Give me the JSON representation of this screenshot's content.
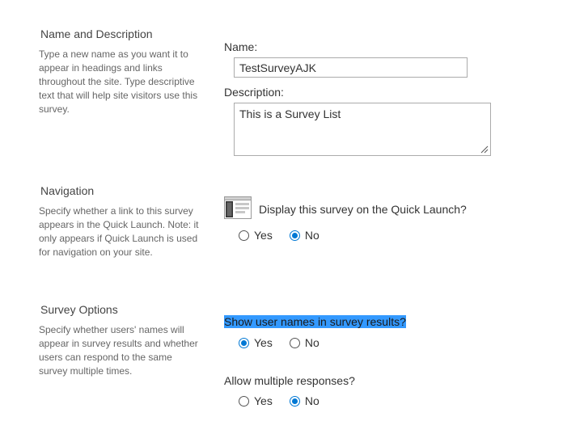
{
  "name_section": {
    "title": "Name and Description",
    "description": "Type a new name as you want it to appear in headings and links throughout the site. Type descriptive text that will help site visitors use this survey.",
    "name_label": "Name:",
    "name_value": "TestSurveyAJK",
    "description_label": "Description:",
    "description_value": "This is a Survey List"
  },
  "navigation_section": {
    "title": "Navigation",
    "description": "Specify whether a link to this survey appears in the Quick Launch. Note: it only appears if Quick Launch is used for navigation on your site.",
    "question": "Display this survey on the Quick Launch?",
    "icon": "quick-launch-icon",
    "yes_label": "Yes",
    "no_label": "No",
    "selected": "No"
  },
  "survey_options_section": {
    "title": "Survey Options",
    "description": "Specify whether users' names will appear in survey results and whether users can respond to the same survey multiple times.",
    "show_names": {
      "question": "Show user names in survey results?",
      "yes_label": "Yes",
      "no_label": "No",
      "selected": "Yes"
    },
    "multiple_responses": {
      "question": "Allow multiple responses?",
      "yes_label": "Yes",
      "no_label": "No",
      "selected": "No"
    }
  },
  "colors": {
    "accent": "#0078d4",
    "selection_highlight": "#3399ff"
  }
}
